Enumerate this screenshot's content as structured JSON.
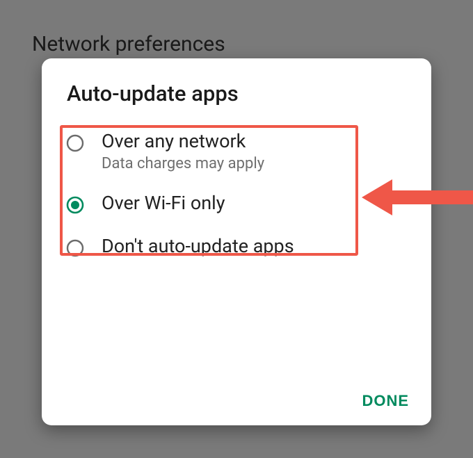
{
  "background": {
    "heading": "Network preferences"
  },
  "dialog": {
    "title": "Auto-update apps",
    "options": [
      {
        "label": "Over any network",
        "sub": "Data charges may apply",
        "selected": false
      },
      {
        "label": "Over Wi-Fi only",
        "sub": "",
        "selected": true
      },
      {
        "label": "Don't auto-update apps",
        "sub": "",
        "selected": false
      }
    ],
    "done_label": "DONE"
  },
  "annotation": {
    "highlight": "options-1-and-2",
    "arrow_color": "#ef5748"
  }
}
